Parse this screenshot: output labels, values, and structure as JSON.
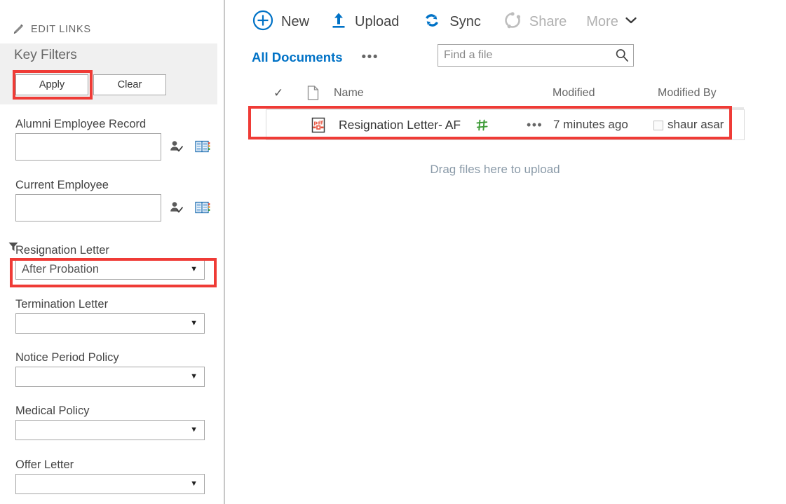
{
  "left_panel": {
    "edit_links": {
      "label": "EDIT LINKS",
      "icon": "pencil-icon"
    },
    "key_filters": {
      "title": "Key Filters",
      "apply_label": "Apply",
      "clear_label": "Clear"
    },
    "fields": [
      {
        "label": "Alumni Employee Record",
        "type": "people-picker",
        "value": "",
        "icons": [
          "check-names-icon",
          "address-book-icon"
        ]
      },
      {
        "label": "Current Employee",
        "type": "people-picker",
        "value": "",
        "icons": [
          "check-names-icon",
          "address-book-icon"
        ]
      },
      {
        "label": "Resignation Letter",
        "type": "dropdown",
        "value": "After Probation",
        "active_filter": true,
        "icon": "filter-funnel-icon"
      },
      {
        "label": "Termination Letter",
        "type": "dropdown",
        "value": ""
      },
      {
        "label": "Notice Period Policy",
        "type": "dropdown",
        "value": ""
      },
      {
        "label": "Medical Policy",
        "type": "dropdown",
        "value": ""
      },
      {
        "label": "Offer Letter",
        "type": "dropdown",
        "value": ""
      }
    ]
  },
  "command_bar": {
    "items": [
      {
        "label": "New",
        "icon": "plus-circle-icon",
        "disabled": false
      },
      {
        "label": "Upload",
        "icon": "upload-arrow-icon",
        "disabled": false
      },
      {
        "label": "Sync",
        "icon": "sync-refresh-icon",
        "disabled": false
      },
      {
        "label": "Share",
        "icon": "share-icon",
        "disabled": true
      },
      {
        "label": "More",
        "icon": "chevron-down-icon",
        "disabled": true
      }
    ]
  },
  "views": {
    "current_view": "All Documents",
    "ellipsis": "•••"
  },
  "search": {
    "placeholder": "Find a file",
    "value": "",
    "icon": "search-magnifier-icon"
  },
  "table": {
    "columns": [
      {
        "key": "select",
        "label": "✓"
      },
      {
        "key": "doctype",
        "label": ""
      },
      {
        "key": "name",
        "label": "Name"
      },
      {
        "key": "modified",
        "label": "Modified"
      },
      {
        "key": "modified_by",
        "label": "Modified By"
      }
    ],
    "rows": [
      {
        "doctype_icon": "pdf-file-icon",
        "name": "Resignation Letter- AF",
        "new_badge": "new-item-sparkle-icon",
        "ellipsis": "•••",
        "modified": "7 minutes ago",
        "modified_by": "shaur asar",
        "presence": "presence-offline-indicator"
      }
    ],
    "drag_hint": "Drag files here to upload"
  },
  "colors": {
    "accent_blue": "#0072c6",
    "annotation_red": "#ef3b36",
    "panel_gray": "#f0f0f0",
    "disabled_gray": "#b1b1b1",
    "new_badge_green": "#3c9a35",
    "pdf_red": "#e8503a"
  }
}
